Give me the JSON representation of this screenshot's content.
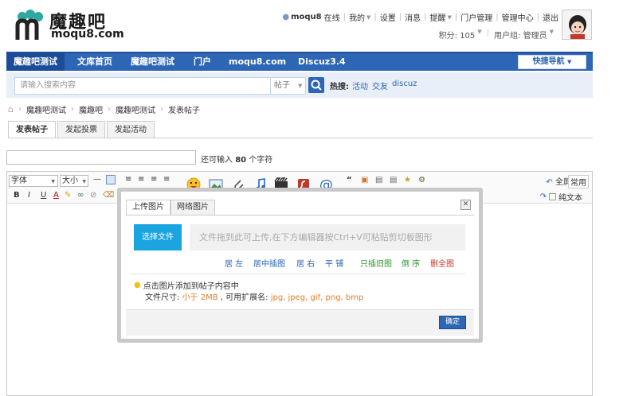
{
  "header": {
    "logo_cn": "魔趣吧",
    "logo_en": "moqu8.com",
    "username": "moqu8",
    "online_status": "在线",
    "top_links": [
      "我的",
      "设置",
      "消息",
      "提醒",
      "门户管理",
      "管理中心",
      "退出"
    ],
    "credits": "积分: 105",
    "usergroup": "用户组: 管理员"
  },
  "nav": {
    "items": [
      "魔趣吧测试",
      "文库首页",
      "魔趣吧测试",
      "门户",
      "moqu8.com",
      "Discuz3.4"
    ],
    "quick_nav": "快捷导航"
  },
  "search": {
    "placeholder": "请输入搜索内容",
    "type": "帖子",
    "hot_label": "热搜:",
    "hot_tags": [
      "活动",
      "交友",
      "discuz"
    ]
  },
  "breadcrumb": [
    "魔趣吧测试",
    "魔趣吧",
    "魔趣吧测试",
    "发表帖子"
  ],
  "post_tabs": [
    "发表帖子",
    "发起投票",
    "发起活动"
  ],
  "title_field": {
    "hint_prefix": "还可输入",
    "hint_count": "80",
    "hint_suffix": "个字符"
  },
  "editor": {
    "font_label": "字体",
    "size_label": "大小",
    "fullscreen": "全屏",
    "common": "常用",
    "plaintext": "纯文本",
    "format_buttons": [
      "B",
      "I",
      "U",
      "A"
    ]
  },
  "dialog": {
    "tabs": [
      "上传图片",
      "网络图片"
    ],
    "select_file": "选择文件",
    "drop_hint": "文件拖到此可上传,在下方编辑器按Ctrl+V可粘贴剪切板图形",
    "align_options": [
      "居 左",
      "居中插图",
      "居 右",
      "平 铺"
    ],
    "only_insert": "只插旧图",
    "reverse": "倒 序",
    "delete_all": "删全图",
    "tip1": "点击图片添加到帖子内容中",
    "tip2_prefix": "文件尺寸: ",
    "tip2_size": "小于 2MB",
    "tip2_mid": " , 可用扩展名: ",
    "tip2_ext": "jpg, jpeg, gif, png, bmp",
    "confirm": "确定"
  },
  "colors": {
    "nav_blue": "#2e66b6",
    "upload_blue": "#1aa4e0"
  }
}
